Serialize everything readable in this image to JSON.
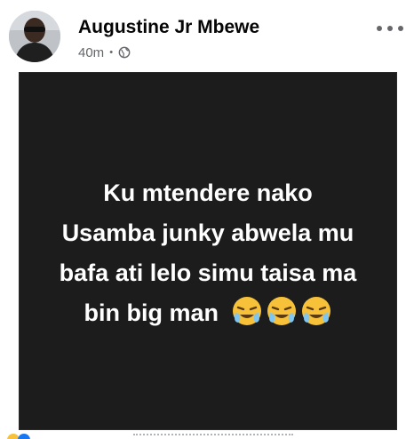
{
  "post": {
    "author": "Augustine Jr Mbewe",
    "timestamp": "40m",
    "separator": "•",
    "privacy_icon": "globe-icon",
    "more_icon": "more-options-icon",
    "status_text_lines": [
      "Ku mtendere nako",
      "Usamba junky abwela mu",
      "bafa ati lelo simu taisa ma",
      "bin big man"
    ],
    "status_emojis": [
      "face-with-tears-icon",
      "face-with-tears-icon",
      "face-with-tears-icon"
    ],
    "background_color": "#1c1c1c",
    "text_color": "#ffffff"
  }
}
